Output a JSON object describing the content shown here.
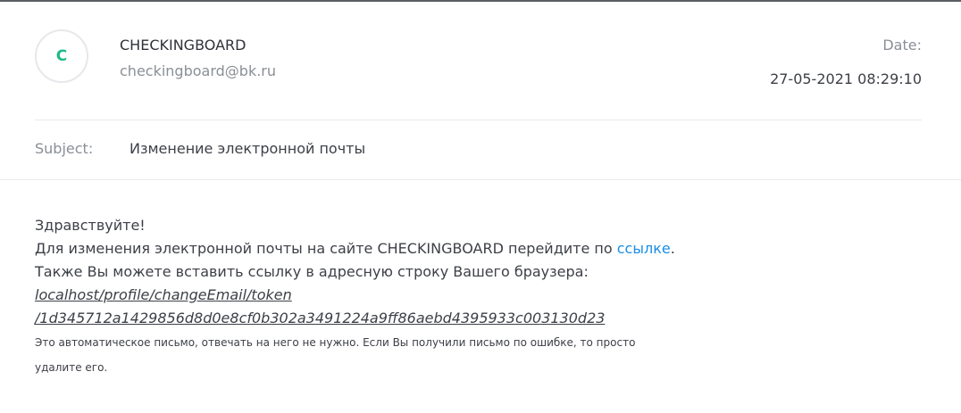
{
  "header": {
    "avatar_letter": "C",
    "sender_name": "CHECKINGBOARD",
    "sender_email": "checkingboard@bk.ru",
    "date_label": "Date:",
    "date_value": "27-05-2021 08:29:10"
  },
  "subject": {
    "label": "Subject:",
    "value": "Изменение электронной почты"
  },
  "body": {
    "greeting": "Здравствуйте!",
    "line1_prefix": "Для изменения электронной почты на сайте CHECKINGBOARD перейдите по ",
    "line1_link": "ссылке",
    "line1_suffix": ".",
    "line2": "Также Вы можете вставить ссылку в адресную строку Вашего браузера:",
    "url_part1": "localhost/profile/changeEmail/token",
    "url_part2": "/1d345712a1429856d8d0e8cf0b302a3491224a9ff86aebd4395933c003130d23",
    "note_line1": "Это автоматическое письмо, отвечать на него не нужно. Если Вы получили письмо по ошибке, то просто",
    "note_line2": "удалите его."
  },
  "colors": {
    "avatar_letter": "#1fb98a",
    "link": "#1a8ee6",
    "muted_text": "#8a8f96"
  }
}
